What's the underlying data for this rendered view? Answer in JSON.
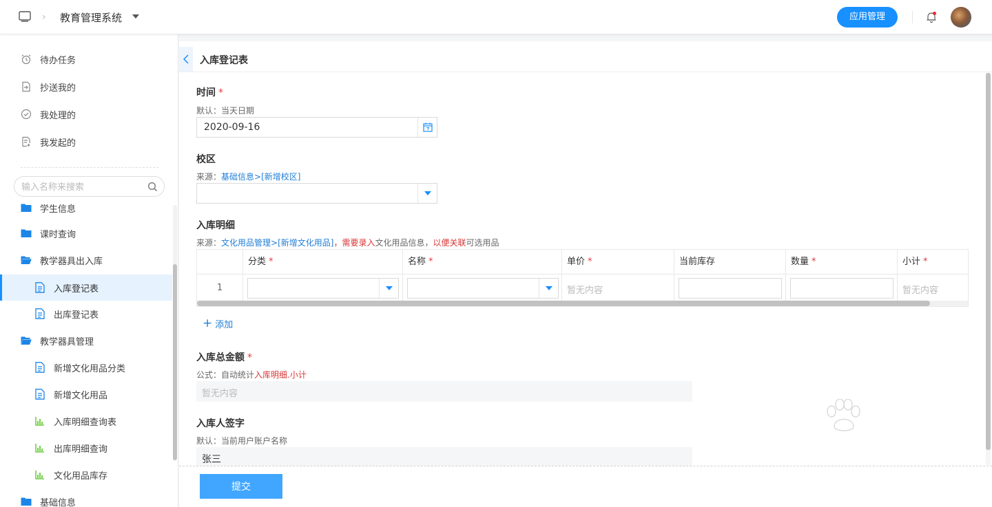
{
  "topbar": {
    "title": "教育管理系统",
    "app_button": "应用管理"
  },
  "sidebar": {
    "top_items": [
      {
        "label": "待办任务",
        "icon": "alarm-clock-icon"
      },
      {
        "label": "抄送我的",
        "icon": "send-doc-icon"
      },
      {
        "label": "我处理的",
        "icon": "check-circle-icon"
      },
      {
        "label": "我发起的",
        "icon": "doc-edit-icon"
      }
    ],
    "search_placeholder": "输入名称来搜索",
    "tree": [
      {
        "label": "学生信息",
        "type": "folder"
      },
      {
        "label": "课时查询",
        "type": "folder"
      },
      {
        "label": "教学器具出入库",
        "type": "folder-open"
      },
      {
        "label": "入库登记表",
        "type": "form",
        "active": true
      },
      {
        "label": "出库登记表",
        "type": "form"
      },
      {
        "label": "教学器具管理",
        "type": "folder-open"
      },
      {
        "label": "新增文化用品分类",
        "type": "form"
      },
      {
        "label": "新增文化用品",
        "type": "form"
      },
      {
        "label": "入库明细查询表",
        "type": "report"
      },
      {
        "label": "出库明细查询",
        "type": "report"
      },
      {
        "label": "文化用品库存",
        "type": "report"
      },
      {
        "label": "基础信息",
        "type": "folder"
      }
    ]
  },
  "form": {
    "title": "入库登记表",
    "time": {
      "label": "时间",
      "required_mark": "*",
      "hint": "默认：当天日期",
      "value": "2020-09-16"
    },
    "campus": {
      "label": "校区",
      "hint_prefix": "来源：",
      "hint_link": "基础信息>[新增校区]"
    },
    "details": {
      "label": "入库明细",
      "hint_prefix": "来源：",
      "hint_link": "文化用品管理>[新增文化用品]",
      "hint_comma1": "，",
      "hint_warn1": "需要录入",
      "hint_mid": "文化用品信息，",
      "hint_warn2": "以便关联",
      "hint_end": "可选用品",
      "columns": [
        {
          "label": "分类",
          "required": "*"
        },
        {
          "label": "名称",
          "required": "*"
        },
        {
          "label": "单价",
          "required": "*"
        },
        {
          "label": "当前库存",
          "required": ""
        },
        {
          "label": "数量",
          "required": "*"
        },
        {
          "label": "小计",
          "required": "*"
        }
      ],
      "row_index": "1",
      "empty_text": "暂无内容",
      "add_label": "添加"
    },
    "total": {
      "label": "入库总金额",
      "required_mark": "*",
      "hint_prefix": "公式：自动统计",
      "hint_ref": "入库明细.小计",
      "value": "暂无内容"
    },
    "signer": {
      "label": "入库人签字",
      "hint": "默认：当前用户账户名称",
      "value": "张三"
    },
    "submit_label": "提交"
  },
  "colors": {
    "primary": "#1890ff",
    "link": "#1f7ed6",
    "required": "#e4393c",
    "sidebar_active_bg": "#e6f2fd"
  }
}
